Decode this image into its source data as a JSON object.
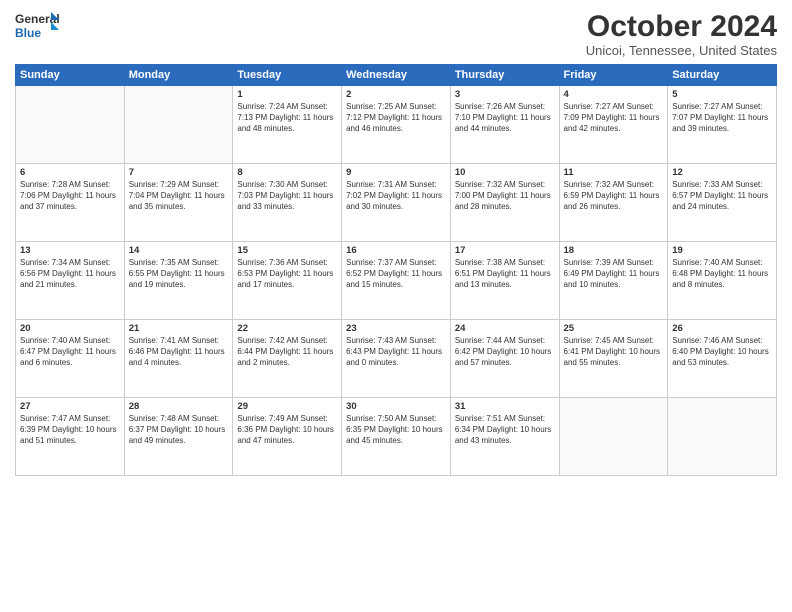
{
  "logo": {
    "line1": "General",
    "line2": "Blue"
  },
  "title": "October 2024",
  "subtitle": "Unicoi, Tennessee, United States",
  "days_header": [
    "Sunday",
    "Monday",
    "Tuesday",
    "Wednesday",
    "Thursday",
    "Friday",
    "Saturday"
  ],
  "weeks": [
    [
      {
        "day": "",
        "info": ""
      },
      {
        "day": "",
        "info": ""
      },
      {
        "day": "1",
        "info": "Sunrise: 7:24 AM\nSunset: 7:13 PM\nDaylight: 11 hours and 48 minutes."
      },
      {
        "day": "2",
        "info": "Sunrise: 7:25 AM\nSunset: 7:12 PM\nDaylight: 11 hours and 46 minutes."
      },
      {
        "day": "3",
        "info": "Sunrise: 7:26 AM\nSunset: 7:10 PM\nDaylight: 11 hours and 44 minutes."
      },
      {
        "day": "4",
        "info": "Sunrise: 7:27 AM\nSunset: 7:09 PM\nDaylight: 11 hours and 42 minutes."
      },
      {
        "day": "5",
        "info": "Sunrise: 7:27 AM\nSunset: 7:07 PM\nDaylight: 11 hours and 39 minutes."
      }
    ],
    [
      {
        "day": "6",
        "info": "Sunrise: 7:28 AM\nSunset: 7:06 PM\nDaylight: 11 hours and 37 minutes."
      },
      {
        "day": "7",
        "info": "Sunrise: 7:29 AM\nSunset: 7:04 PM\nDaylight: 11 hours and 35 minutes."
      },
      {
        "day": "8",
        "info": "Sunrise: 7:30 AM\nSunset: 7:03 PM\nDaylight: 11 hours and 33 minutes."
      },
      {
        "day": "9",
        "info": "Sunrise: 7:31 AM\nSunset: 7:02 PM\nDaylight: 11 hours and 30 minutes."
      },
      {
        "day": "10",
        "info": "Sunrise: 7:32 AM\nSunset: 7:00 PM\nDaylight: 11 hours and 28 minutes."
      },
      {
        "day": "11",
        "info": "Sunrise: 7:32 AM\nSunset: 6:59 PM\nDaylight: 11 hours and 26 minutes."
      },
      {
        "day": "12",
        "info": "Sunrise: 7:33 AM\nSunset: 6:57 PM\nDaylight: 11 hours and 24 minutes."
      }
    ],
    [
      {
        "day": "13",
        "info": "Sunrise: 7:34 AM\nSunset: 6:56 PM\nDaylight: 11 hours and 21 minutes."
      },
      {
        "day": "14",
        "info": "Sunrise: 7:35 AM\nSunset: 6:55 PM\nDaylight: 11 hours and 19 minutes."
      },
      {
        "day": "15",
        "info": "Sunrise: 7:36 AM\nSunset: 6:53 PM\nDaylight: 11 hours and 17 minutes."
      },
      {
        "day": "16",
        "info": "Sunrise: 7:37 AM\nSunset: 6:52 PM\nDaylight: 11 hours and 15 minutes."
      },
      {
        "day": "17",
        "info": "Sunrise: 7:38 AM\nSunset: 6:51 PM\nDaylight: 11 hours and 13 minutes."
      },
      {
        "day": "18",
        "info": "Sunrise: 7:39 AM\nSunset: 6:49 PM\nDaylight: 11 hours and 10 minutes."
      },
      {
        "day": "19",
        "info": "Sunrise: 7:40 AM\nSunset: 6:48 PM\nDaylight: 11 hours and 8 minutes."
      }
    ],
    [
      {
        "day": "20",
        "info": "Sunrise: 7:40 AM\nSunset: 6:47 PM\nDaylight: 11 hours and 6 minutes."
      },
      {
        "day": "21",
        "info": "Sunrise: 7:41 AM\nSunset: 6:46 PM\nDaylight: 11 hours and 4 minutes."
      },
      {
        "day": "22",
        "info": "Sunrise: 7:42 AM\nSunset: 6:44 PM\nDaylight: 11 hours and 2 minutes."
      },
      {
        "day": "23",
        "info": "Sunrise: 7:43 AM\nSunset: 6:43 PM\nDaylight: 11 hours and 0 minutes."
      },
      {
        "day": "24",
        "info": "Sunrise: 7:44 AM\nSunset: 6:42 PM\nDaylight: 10 hours and 57 minutes."
      },
      {
        "day": "25",
        "info": "Sunrise: 7:45 AM\nSunset: 6:41 PM\nDaylight: 10 hours and 55 minutes."
      },
      {
        "day": "26",
        "info": "Sunrise: 7:46 AM\nSunset: 6:40 PM\nDaylight: 10 hours and 53 minutes."
      }
    ],
    [
      {
        "day": "27",
        "info": "Sunrise: 7:47 AM\nSunset: 6:39 PM\nDaylight: 10 hours and 51 minutes."
      },
      {
        "day": "28",
        "info": "Sunrise: 7:48 AM\nSunset: 6:37 PM\nDaylight: 10 hours and 49 minutes."
      },
      {
        "day": "29",
        "info": "Sunrise: 7:49 AM\nSunset: 6:36 PM\nDaylight: 10 hours and 47 minutes."
      },
      {
        "day": "30",
        "info": "Sunrise: 7:50 AM\nSunset: 6:35 PM\nDaylight: 10 hours and 45 minutes."
      },
      {
        "day": "31",
        "info": "Sunrise: 7:51 AM\nSunset: 6:34 PM\nDaylight: 10 hours and 43 minutes."
      },
      {
        "day": "",
        "info": ""
      },
      {
        "day": "",
        "info": ""
      }
    ]
  ]
}
